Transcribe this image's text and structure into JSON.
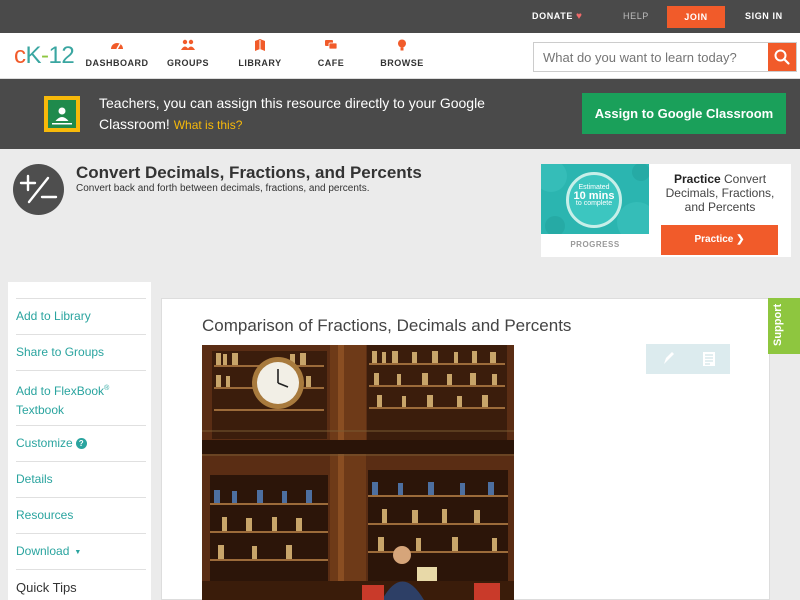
{
  "topbar": {
    "donate": "DONATE",
    "help": "HELP",
    "join": "JOIN",
    "signin": "SIGN IN"
  },
  "nav": {
    "logo": {
      "c": "c",
      "k": "K",
      "dash": "-",
      "num": "12"
    },
    "items": [
      {
        "label": "DASHBOARD",
        "icon": "dashboard-icon"
      },
      {
        "label": "GROUPS",
        "icon": "groups-icon"
      },
      {
        "label": "LIBRARY",
        "icon": "library-icon"
      },
      {
        "label": "CAFE",
        "icon": "cafe-icon"
      },
      {
        "label": "BROWSE",
        "icon": "browse-icon"
      }
    ],
    "search_placeholder": "What do you want to learn today?"
  },
  "banner": {
    "text": "Teachers, you can assign this resource directly to your Google Classroom!",
    "what": "What is this?",
    "button": "Assign to Google Classroom"
  },
  "concept": {
    "title": "Convert Decimals, Fractions, and Percents",
    "subtitle": "Convert back and forth between decimals, fractions, and percents."
  },
  "practice": {
    "estimated": "Estimated",
    "mins": "10 mins",
    "to_complete": "to complete",
    "progress": "PROGRESS",
    "bold": "Practice",
    "rest": " Convert Decimals, Fractions, and Percents",
    "button": "Practice"
  },
  "sidebar": {
    "items": [
      {
        "label": "Add to Library"
      },
      {
        "label": "Share to Groups"
      },
      {
        "label": "Add to FlexBook",
        "sup": "®",
        "line2": "Textbook"
      },
      {
        "label": "Customize",
        "badge": "?"
      },
      {
        "label": "Details"
      },
      {
        "label": "Resources"
      },
      {
        "label": "Download",
        "caret": "▼"
      },
      {
        "label": "Quick Tips"
      }
    ]
  },
  "content": {
    "title": "Comparison of Fractions, Decimals and Percents",
    "support": "Support"
  },
  "colors": {
    "accent": "#f15b2a",
    "teal": "#2aa49f",
    "green": "#1aa05a",
    "banner_bg": "#4a4a4a"
  }
}
